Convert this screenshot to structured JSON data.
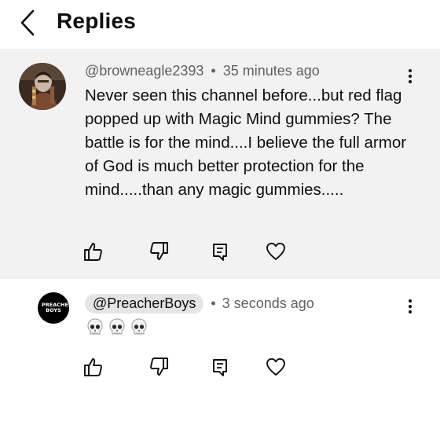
{
  "header": {
    "title": "Replies"
  },
  "parent_comment": {
    "handle": "@browneagle2393",
    "separator": "•",
    "time": "35 minutes ago",
    "text": "Never seen this channel before...but red flag popped up with Magic Mind gummies? The battle is for the mind....I believe the full armor of God is much better protection for the mind.....than any magic gummies....."
  },
  "reply": {
    "avatar_text": "PREACHER BOYS",
    "handle": "@PreacherBoys",
    "separator": "•",
    "time": "3 seconds ago",
    "emoji_count": 3
  },
  "icons": [
    "back-chevron-icon",
    "thumbs-up-icon",
    "thumbs-down-icon",
    "reply-comment-icon",
    "heart-icon",
    "more-vertical-icon",
    "skull-icon"
  ],
  "colors": {
    "parent_bg": "#f2f2f2",
    "pill_bg": "#e5e5e5",
    "meta_text": "#606060"
  }
}
